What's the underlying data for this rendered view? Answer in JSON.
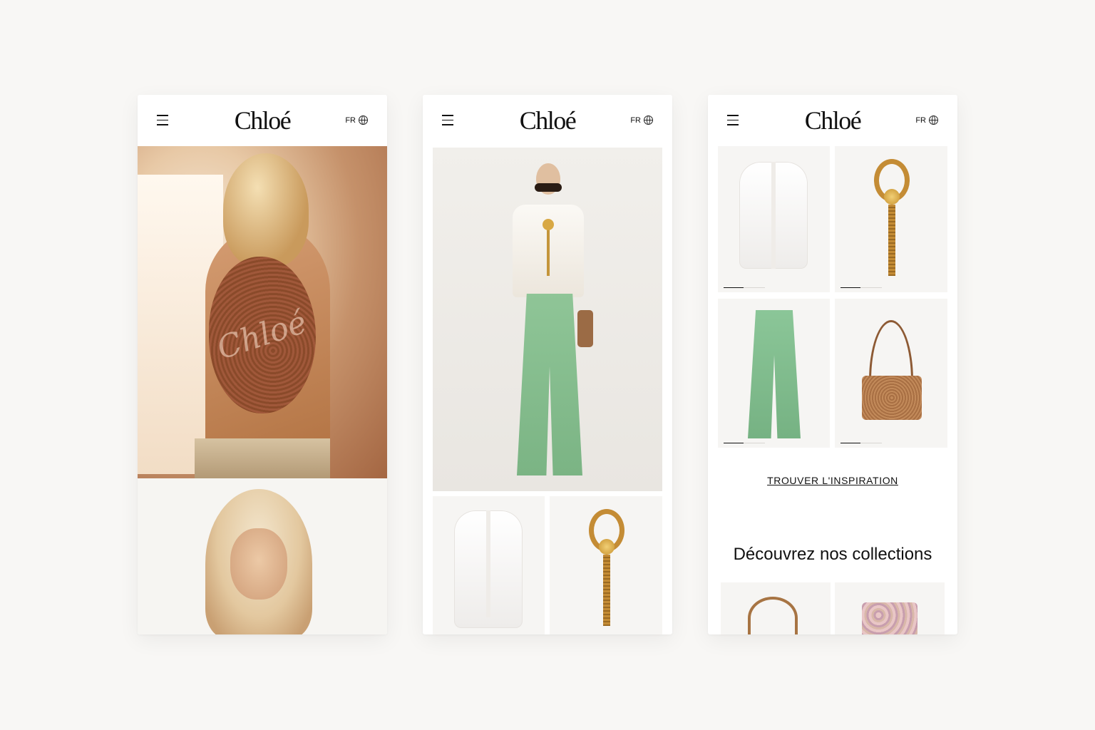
{
  "brand": {
    "logo_text": "Chloé"
  },
  "header": {
    "language_label": "FR",
    "globe_icon": "globe-icon",
    "menu_icon": "hamburger-menu-icon"
  },
  "screen_3": {
    "inspiration_link": "TROUVER L'INSPIRATION",
    "collections_title": "Découvrez nos collections"
  },
  "colors": {
    "page_background": "#f8f7f5",
    "card_background": "#ffffff",
    "product_background": "#f6f5f3",
    "text": "#111111"
  }
}
